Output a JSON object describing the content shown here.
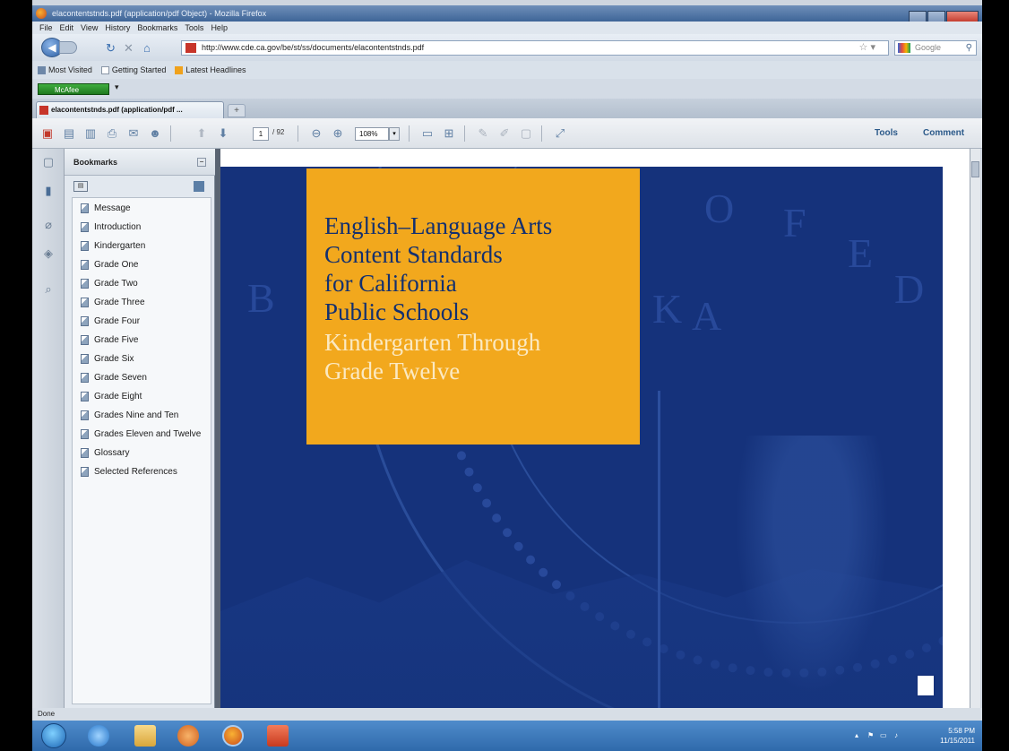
{
  "window": {
    "title": "elacontentstnds.pdf (application/pdf Object) - Mozilla Firefox"
  },
  "menu": [
    "File",
    "Edit",
    "View",
    "History",
    "Bookmarks",
    "Tools",
    "Help"
  ],
  "nav": {
    "url": "http://www.cde.ca.gov/be/st/ss/documents/elacontentstnds.pdf",
    "search_placeholder": "Google"
  },
  "bookmarks_toolbar": [
    "Most Visited",
    "Getting Started",
    "Latest Headlines"
  ],
  "mcafee": {
    "label": "McAfee"
  },
  "tab": {
    "label": "elacontentstnds.pdf (application/pdf ...",
    "new_tab": "+"
  },
  "pdf_toolbar": {
    "page_current": "1",
    "page_total": "/ 92",
    "zoom": "108%",
    "tools": "Tools",
    "comment": "Comment"
  },
  "bookmarks_panel": {
    "title": "Bookmarks",
    "items": [
      "Message",
      "Introduction",
      "Kindergarten",
      "Grade One",
      "Grade Two",
      "Grade Three",
      "Grade Four",
      "Grade Five",
      "Grade Six",
      "Grade Seven",
      "Grade Eight",
      "Grades Nine and Ten",
      "Grades Eleven and Twelve",
      "Glossary",
      "Selected References"
    ]
  },
  "document": {
    "title_lines": [
      "English–Language Arts",
      "Content Standards",
      "for California",
      "Public Schools"
    ],
    "subtitle_lines": [
      "Kindergarten Through",
      "Grade Twelve"
    ],
    "seal_letters": [
      "B",
      "O",
      "F",
      "E",
      "D",
      "K",
      "A"
    ],
    "colors": {
      "cover_blue": "#15327b",
      "title_box": "#f2a81d"
    }
  },
  "status": {
    "text": "Done"
  },
  "taskbar": {
    "time": "5:58 PM",
    "date": "11/15/2011"
  }
}
